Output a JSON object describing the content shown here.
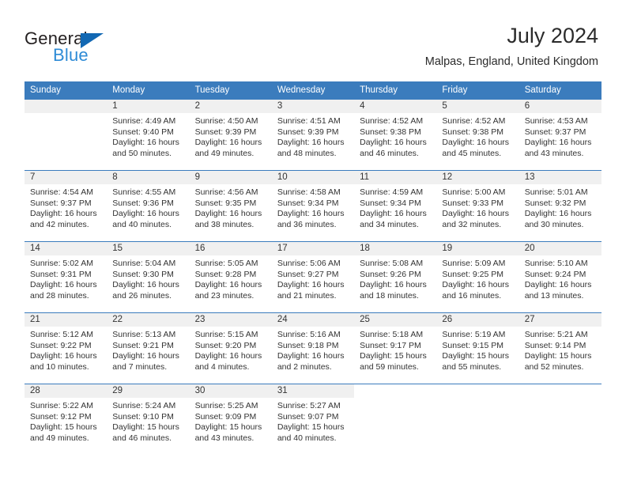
{
  "logo": {
    "word_dark": "General",
    "word_blue": "Blue",
    "triangle_color": "#1268b3",
    "blue_text_color": "#2e8bd6"
  },
  "header": {
    "title": "July 2024",
    "subtitle": "Malpas, England, United Kingdom"
  },
  "theme": {
    "header_blue": "#3b7cbd",
    "day_band_gray": "#f0f0f0",
    "text_color": "#333333"
  },
  "weekday_headers": [
    "Sunday",
    "Monday",
    "Tuesday",
    "Wednesday",
    "Thursday",
    "Friday",
    "Saturday"
  ],
  "labels": {
    "sunrise_prefix": "Sunrise:",
    "sunset_prefix": "Sunset:",
    "daylight_prefix": "Daylight:"
  },
  "weeks": [
    [
      {
        "day": "",
        "empty": true,
        "l1": "",
        "l2": "",
        "l3": "",
        "l4": ""
      },
      {
        "day": "1",
        "l1": "Sunrise: 4:49 AM",
        "l2": "Sunset: 9:40 PM",
        "l3": "Daylight: 16 hours",
        "l4": "and 50 minutes."
      },
      {
        "day": "2",
        "l1": "Sunrise: 4:50 AM",
        "l2": "Sunset: 9:39 PM",
        "l3": "Daylight: 16 hours",
        "l4": "and 49 minutes."
      },
      {
        "day": "3",
        "l1": "Sunrise: 4:51 AM",
        "l2": "Sunset: 9:39 PM",
        "l3": "Daylight: 16 hours",
        "l4": "and 48 minutes."
      },
      {
        "day": "4",
        "l1": "Sunrise: 4:52 AM",
        "l2": "Sunset: 9:38 PM",
        "l3": "Daylight: 16 hours",
        "l4": "and 46 minutes."
      },
      {
        "day": "5",
        "l1": "Sunrise: 4:52 AM",
        "l2": "Sunset: 9:38 PM",
        "l3": "Daylight: 16 hours",
        "l4": "and 45 minutes."
      },
      {
        "day": "6",
        "l1": "Sunrise: 4:53 AM",
        "l2": "Sunset: 9:37 PM",
        "l3": "Daylight: 16 hours",
        "l4": "and 43 minutes."
      }
    ],
    [
      {
        "day": "7",
        "l1": "Sunrise: 4:54 AM",
        "l2": "Sunset: 9:37 PM",
        "l3": "Daylight: 16 hours",
        "l4": "and 42 minutes."
      },
      {
        "day": "8",
        "l1": "Sunrise: 4:55 AM",
        "l2": "Sunset: 9:36 PM",
        "l3": "Daylight: 16 hours",
        "l4": "and 40 minutes."
      },
      {
        "day": "9",
        "l1": "Sunrise: 4:56 AM",
        "l2": "Sunset: 9:35 PM",
        "l3": "Daylight: 16 hours",
        "l4": "and 38 minutes."
      },
      {
        "day": "10",
        "l1": "Sunrise: 4:58 AM",
        "l2": "Sunset: 9:34 PM",
        "l3": "Daylight: 16 hours",
        "l4": "and 36 minutes."
      },
      {
        "day": "11",
        "l1": "Sunrise: 4:59 AM",
        "l2": "Sunset: 9:34 PM",
        "l3": "Daylight: 16 hours",
        "l4": "and 34 minutes."
      },
      {
        "day": "12",
        "l1": "Sunrise: 5:00 AM",
        "l2": "Sunset: 9:33 PM",
        "l3": "Daylight: 16 hours",
        "l4": "and 32 minutes."
      },
      {
        "day": "13",
        "l1": "Sunrise: 5:01 AM",
        "l2": "Sunset: 9:32 PM",
        "l3": "Daylight: 16 hours",
        "l4": "and 30 minutes."
      }
    ],
    [
      {
        "day": "14",
        "l1": "Sunrise: 5:02 AM",
        "l2": "Sunset: 9:31 PM",
        "l3": "Daylight: 16 hours",
        "l4": "and 28 minutes."
      },
      {
        "day": "15",
        "l1": "Sunrise: 5:04 AM",
        "l2": "Sunset: 9:30 PM",
        "l3": "Daylight: 16 hours",
        "l4": "and 26 minutes."
      },
      {
        "day": "16",
        "l1": "Sunrise: 5:05 AM",
        "l2": "Sunset: 9:28 PM",
        "l3": "Daylight: 16 hours",
        "l4": "and 23 minutes."
      },
      {
        "day": "17",
        "l1": "Sunrise: 5:06 AM",
        "l2": "Sunset: 9:27 PM",
        "l3": "Daylight: 16 hours",
        "l4": "and 21 minutes."
      },
      {
        "day": "18",
        "l1": "Sunrise: 5:08 AM",
        "l2": "Sunset: 9:26 PM",
        "l3": "Daylight: 16 hours",
        "l4": "and 18 minutes."
      },
      {
        "day": "19",
        "l1": "Sunrise: 5:09 AM",
        "l2": "Sunset: 9:25 PM",
        "l3": "Daylight: 16 hours",
        "l4": "and 16 minutes."
      },
      {
        "day": "20",
        "l1": "Sunrise: 5:10 AM",
        "l2": "Sunset: 9:24 PM",
        "l3": "Daylight: 16 hours",
        "l4": "and 13 minutes."
      }
    ],
    [
      {
        "day": "21",
        "l1": "Sunrise: 5:12 AM",
        "l2": "Sunset: 9:22 PM",
        "l3": "Daylight: 16 hours",
        "l4": "and 10 minutes."
      },
      {
        "day": "22",
        "l1": "Sunrise: 5:13 AM",
        "l2": "Sunset: 9:21 PM",
        "l3": "Daylight: 16 hours",
        "l4": "and 7 minutes."
      },
      {
        "day": "23",
        "l1": "Sunrise: 5:15 AM",
        "l2": "Sunset: 9:20 PM",
        "l3": "Daylight: 16 hours",
        "l4": "and 4 minutes."
      },
      {
        "day": "24",
        "l1": "Sunrise: 5:16 AM",
        "l2": "Sunset: 9:18 PM",
        "l3": "Daylight: 16 hours",
        "l4": "and 2 minutes."
      },
      {
        "day": "25",
        "l1": "Sunrise: 5:18 AM",
        "l2": "Sunset: 9:17 PM",
        "l3": "Daylight: 15 hours",
        "l4": "and 59 minutes."
      },
      {
        "day": "26",
        "l1": "Sunrise: 5:19 AM",
        "l2": "Sunset: 9:15 PM",
        "l3": "Daylight: 15 hours",
        "l4": "and 55 minutes."
      },
      {
        "day": "27",
        "l1": "Sunrise: 5:21 AM",
        "l2": "Sunset: 9:14 PM",
        "l3": "Daylight: 15 hours",
        "l4": "and 52 minutes."
      }
    ],
    [
      {
        "day": "28",
        "l1": "Sunrise: 5:22 AM",
        "l2": "Sunset: 9:12 PM",
        "l3": "Daylight: 15 hours",
        "l4": "and 49 minutes."
      },
      {
        "day": "29",
        "l1": "Sunrise: 5:24 AM",
        "l2": "Sunset: 9:10 PM",
        "l3": "Daylight: 15 hours",
        "l4": "and 46 minutes."
      },
      {
        "day": "30",
        "l1": "Sunrise: 5:25 AM",
        "l2": "Sunset: 9:09 PM",
        "l3": "Daylight: 15 hours",
        "l4": "and 43 minutes."
      },
      {
        "day": "31",
        "l1": "Sunrise: 5:27 AM",
        "l2": "Sunset: 9:07 PM",
        "l3": "Daylight: 15 hours",
        "l4": "and 40 minutes."
      },
      {
        "day": "",
        "empty": true,
        "blank": true,
        "l1": "",
        "l2": "",
        "l3": "",
        "l4": ""
      },
      {
        "day": "",
        "empty": true,
        "blank": true,
        "l1": "",
        "l2": "",
        "l3": "",
        "l4": ""
      },
      {
        "day": "",
        "empty": true,
        "blank": true,
        "l1": "",
        "l2": "",
        "l3": "",
        "l4": ""
      }
    ]
  ]
}
